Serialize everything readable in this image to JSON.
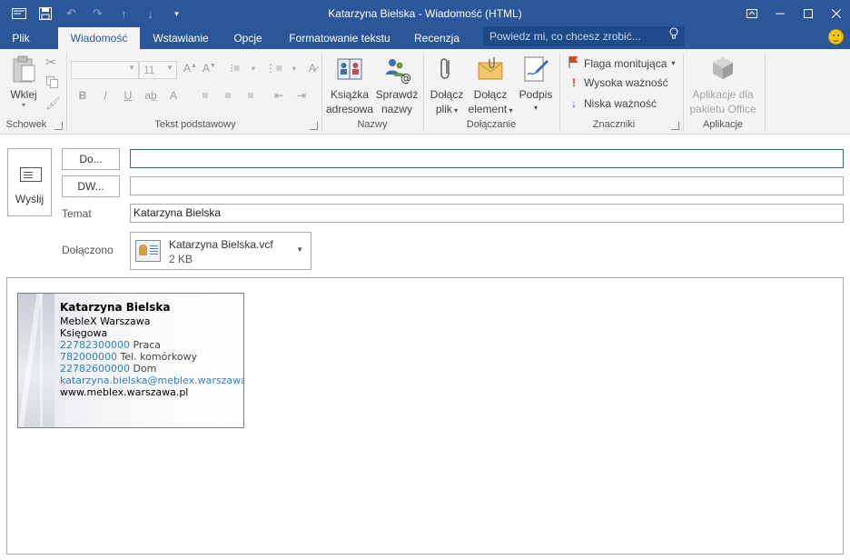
{
  "window": {
    "title": "Katarzyna Bielska - Wiadomość (HTML)"
  },
  "ribbon_tabs": [
    {
      "label": "Plik"
    },
    {
      "label": "Wiadomość"
    },
    {
      "label": "Wstawianie"
    },
    {
      "label": "Opcje"
    },
    {
      "label": "Formatowanie tekstu"
    },
    {
      "label": "Recenzja"
    }
  ],
  "tell_me": {
    "placeholder": "Powiedz mi, co chcesz zrobić..."
  },
  "ribbon": {
    "schowek": {
      "paste_label": "Wklej",
      "group_label": "Schowek"
    },
    "tekst": {
      "font_size": "11",
      "group_label": "Tekst podstawowy"
    },
    "nazwy": {
      "address_book_line1": "Książka",
      "address_book_line2": "adresowa",
      "check_names_line1": "Sprawdź",
      "check_names_line2": "nazwy",
      "group_label": "Nazwy"
    },
    "dolaczanie": {
      "attach_file_line1": "Dołącz",
      "attach_file_line2": "plik",
      "attach_item_line1": "Dołącz",
      "attach_item_line2": "element",
      "signature_label": "Podpis",
      "group_label": "Dołączanie"
    },
    "znaczniki": {
      "follow_up": "Flaga monitująca",
      "high_importance": "Wysoka ważność",
      "low_importance": "Niska ważność",
      "group_label": "Znaczniki"
    },
    "aplikacje": {
      "office_apps_line1": "Aplikacje dla",
      "office_apps_line2": "pakietu Office",
      "group_label": "Aplikacje"
    }
  },
  "compose": {
    "send_label": "Wyślij",
    "to_button": "Do...",
    "cc_button": "DW...",
    "to_value": "",
    "cc_value": "",
    "subject_label": "Temat",
    "subject_value": "Katarzyna Bielska",
    "attached_label": "Dołączono",
    "attachment": {
      "name": "Katarzyna Bielska.vcf",
      "size": "2 KB"
    }
  },
  "business_card": {
    "name": "Katarzyna Bielska",
    "company": "MebleX Warszawa",
    "title": "Księgowa",
    "work_phone": "22782300000",
    "work_label": "Praca",
    "mobile_phone": "782000000",
    "mobile_label": "Tel. komórkowy",
    "home_phone": "22782600000",
    "home_label": "Dom",
    "email": "katarzyna.bielska@meblex.warszawa.pl",
    "website": "www.meblex.warszawa.pl"
  },
  "colors": {
    "accent": "#2b579a",
    "link": "#2e7fc1"
  }
}
